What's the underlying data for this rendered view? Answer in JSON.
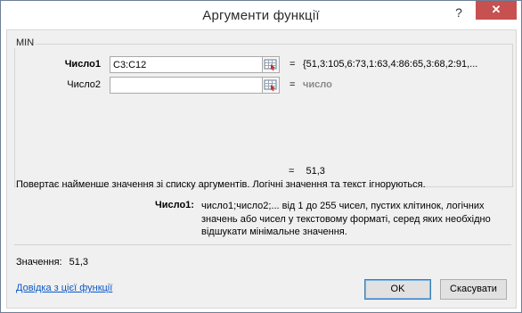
{
  "window": {
    "title": "Аргументи функції",
    "help_glyph": "?",
    "close_glyph": "✕"
  },
  "function": {
    "name": "MIN"
  },
  "arguments": [
    {
      "label": "Число1",
      "value": "C3:C12",
      "result": "{51,3:105,6:73,1:63,4:86:65,3:68,2:91,..."
    },
    {
      "label": "Число2",
      "value": "",
      "result": "число"
    }
  ],
  "equals": "=",
  "result_value": "51,3",
  "description": "Повертає найменше значення зі списку аргументів. Логічні значення та текст ігноруються.",
  "argument_help": {
    "name": "Число1:",
    "text": "число1;число2;... від 1 до 255 чисел, пустих клітинок, логічних значень або чисел у текстовому форматі, серед яких необхідно відшукати мінімальне значення."
  },
  "value_label": "Значення:",
  "value": "51,3",
  "help_link": "Довідка з цієї функції",
  "buttons": {
    "ok": "OK",
    "cancel": "Скасувати"
  },
  "colors": {
    "close_button": "#c75050",
    "link": "#0b58c7",
    "panel": "#f0f0f0"
  }
}
